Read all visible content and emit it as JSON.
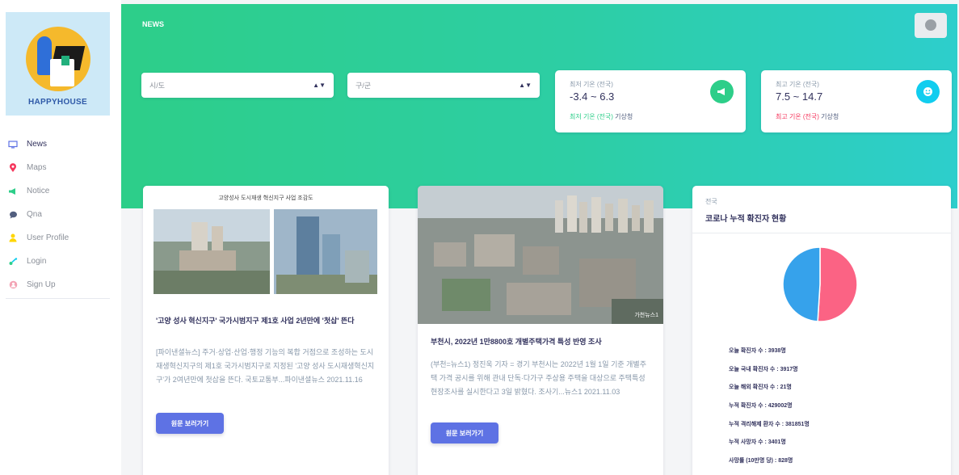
{
  "brand": {
    "logo_text": "HAPPYHOUSE"
  },
  "sidebar": {
    "items": [
      {
        "label": "News",
        "icon": "monitor-icon",
        "color": "#5e72e4"
      },
      {
        "label": "Maps",
        "icon": "map-pin-icon",
        "color": "#f5365c"
      },
      {
        "label": "Notice",
        "icon": "megaphone-icon",
        "color": "#2dce89"
      },
      {
        "label": "Qna",
        "icon": "chat-bubble-icon",
        "color": "#525f7f"
      },
      {
        "label": "User Profile",
        "icon": "user-icon",
        "color": "#ffd600"
      },
      {
        "label": "Login",
        "icon": "key-icon",
        "color": "#11cdef"
      },
      {
        "label": "Sign Up",
        "icon": "user-add-icon",
        "color": "#f3a4b5"
      }
    ]
  },
  "header": {
    "title": "NEWS"
  },
  "filters": {
    "city_select": "시/도",
    "district_select": "구/군"
  },
  "weather": {
    "min": {
      "label": "최저 기온 (전국)",
      "value": "-3.4 ~ 6.3",
      "foot_highlight": "최저 기온 (전국)",
      "foot_source": "기상청",
      "icon": "megaphone-icon",
      "icon_color": "#2dce89"
    },
    "max": {
      "label": "최고 기온 (전국)",
      "value": "7.5 ~ 14.7",
      "foot_highlight": "최고 기온 (전국)",
      "foot_source": "기상청",
      "icon": "smile-icon",
      "icon_color": "#11cdef"
    }
  },
  "news": [
    {
      "image_caption": "고양성사 도시재생 혁신지구 사업 조감도",
      "title": "'고양 성사 혁신지구' 국가시범지구 제1호 사업 2년만에 '첫삽' 뜬다",
      "body": "[파이낸셜뉴스] 주거·상업·산업·행정 기능의 복합 거점으로 조성하는 도시재생혁신지구의 제1호 국가시범지구로 지정된 '고양 성사 도시재생혁신지구'가 2여년만에 첫삽을 뜬다. 국토교통부...파이낸셜뉴스 2021.11.16",
      "button": "원문 보러가기"
    },
    {
      "image_watermark": "가천뉴스1",
      "title": "부천시, 2022년 1만8800호 개별주택가격 특성 반영 조사",
      "body": "(부천=뉴스1) 정진욱 기자 = 경기 부천시는 2022년 1월 1일 기준 개별주택 가격 공시를 위해 관내 단독·다가구 주상용 주택을 대상으로 주택특성 현장조사를 실시한다고 3일 밝혔다. 조사기...뉴스1 2021.11.03",
      "button": "원문 보러가기"
    }
  ],
  "covid": {
    "subtitle": "전국",
    "title": "코로나 누적 확진자 현황",
    "chart_data": {
      "type": "pie",
      "values": [
        51,
        49
      ],
      "colors": [
        "#fb6384",
        "#36a2eb"
      ]
    },
    "stats": [
      "오늘 확진자 수 : 3938명",
      "오늘 국내 확진자 수 : 3917명",
      "오늘 해외 확진자 수 : 21명",
      "누적 확진자 수 : 429002명",
      "누적 격리해제 환자 수 : 381851명",
      "누적 사망자 수 : 3401명",
      "사망률 (10만명 당) : 828명"
    ]
  }
}
